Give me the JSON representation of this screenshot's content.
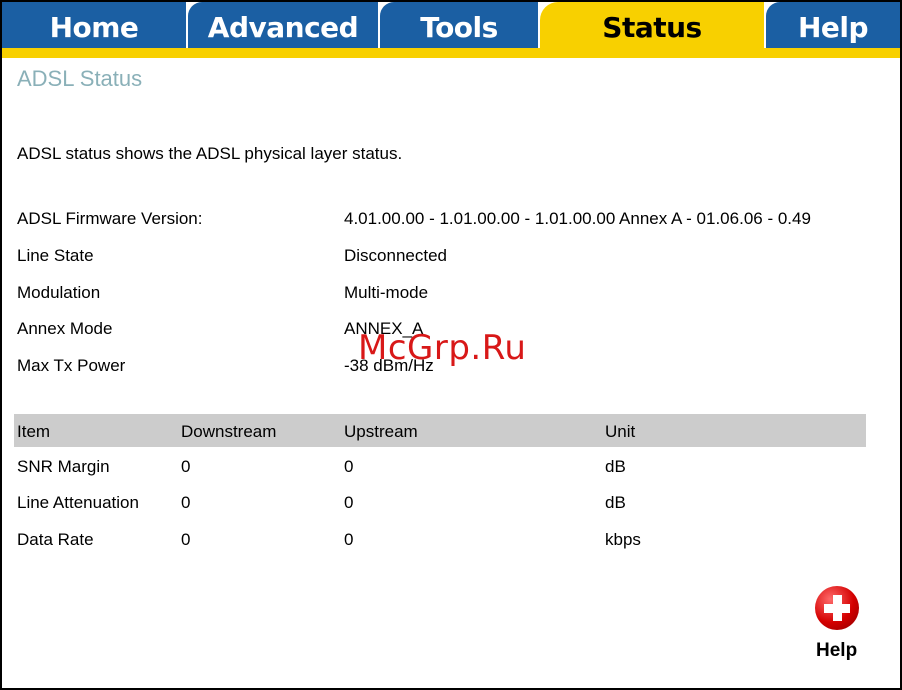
{
  "tabs": [
    {
      "label": "Home"
    },
    {
      "label": "Advanced"
    },
    {
      "label": "Tools"
    },
    {
      "label": "Status",
      "active": true
    },
    {
      "label": "Help"
    }
  ],
  "colors": {
    "tab_blue": "#1b5fa3",
    "tab_active_yellow": "#f8d000",
    "title_gray_blue": "#8ab0b8",
    "table_header_gray": "#cccccc"
  },
  "page": {
    "title": "ADSL Status",
    "description": "ADSL status shows the ADSL physical layer status."
  },
  "info": [
    {
      "label": "ADSL Firmware Version:",
      "value": "4.01.00.00 - 1.01.00.00 - 1.01.00.00 Annex A - 01.06.06 - 0.49"
    },
    {
      "label": "Line State",
      "value": "Disconnected"
    },
    {
      "label": "Modulation",
      "value": "Multi-mode"
    },
    {
      "label": "Annex Mode",
      "value": "ANNEX_A"
    },
    {
      "label": "Max Tx Power",
      "value": "-38 dBm/Hz"
    }
  ],
  "table": {
    "headers": [
      "Item",
      "Downstream",
      "Upstream",
      "Unit"
    ],
    "rows": [
      [
        "SNR Margin",
        "0",
        "0",
        "dB"
      ],
      [
        "Line Attenuation",
        "0",
        "0",
        "dB"
      ],
      [
        "Data Rate",
        "0",
        "0",
        "kbps"
      ]
    ]
  },
  "help_button": {
    "label": "Help",
    "icon": "plus-circle-icon"
  },
  "watermark": "McGrp.Ru"
}
